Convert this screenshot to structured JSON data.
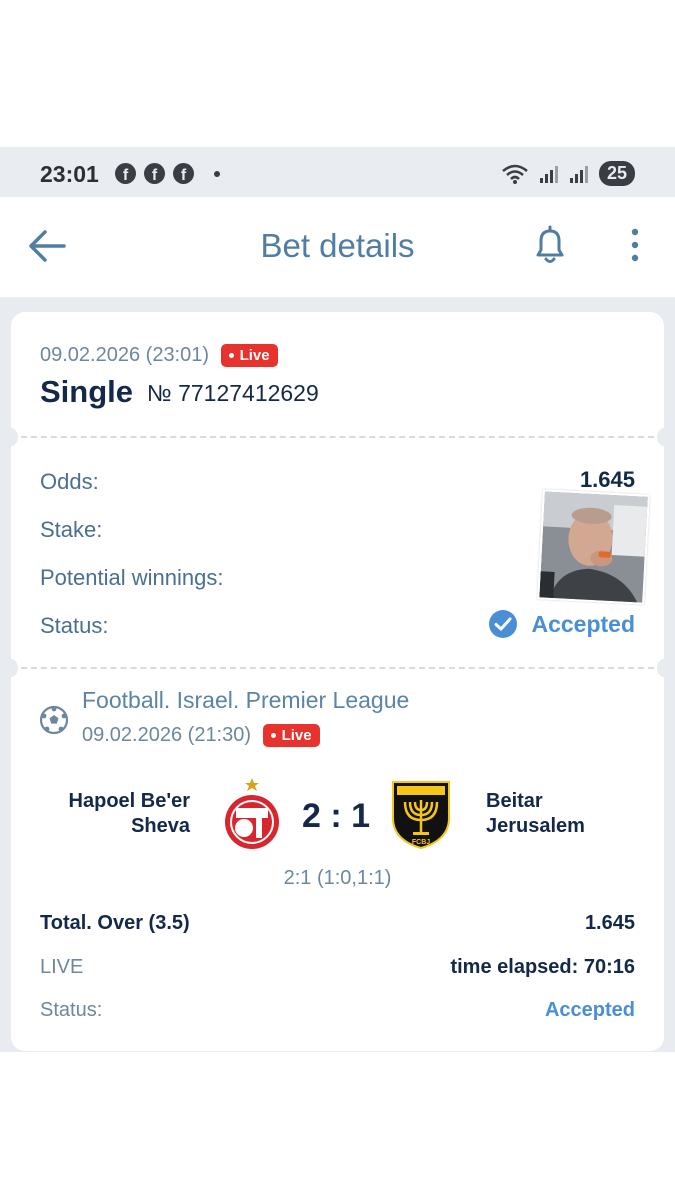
{
  "status_bar": {
    "time": "23:01",
    "battery": "25",
    "notification_icons": [
      "facebook-icon",
      "facebook-icon",
      "facebook-icon"
    ]
  },
  "app_bar": {
    "title": "Bet details"
  },
  "bet": {
    "datetime": "09.02.2026 (23:01)",
    "live_label": "Live",
    "type": "Single",
    "number": "№ 77127412629",
    "odds_label": "Odds:",
    "odds_value": "1.645",
    "stake_label": "Stake:",
    "potential_label": "Potential winnings:",
    "status_label": "Status:",
    "status_value": "Accepted"
  },
  "event": {
    "league": "Football. Israel. Premier League",
    "datetime": "09.02.2026 (21:30)",
    "live_label": "Live",
    "home_team": "Hapoel Be'er Sheva",
    "away_team": "Beitar Jerusalem",
    "score": "2 : 1",
    "score_detail": "2:1 (1:0,1:1)",
    "market": "Total. Over (3.5)",
    "market_odds": "1.645",
    "live_text": "LIVE",
    "time_elapsed": "time elapsed: 70:16",
    "status_label": "Status:",
    "status_value": "Accepted",
    "away_logo_text": "FCBJ"
  },
  "colors": {
    "accent": "#4f7ea2",
    "live": "#e8322d",
    "accepted": "#4a8fd6",
    "dark_text": "#14284a",
    "home_red": "#d9262e",
    "away_yellow": "#f5c518"
  }
}
